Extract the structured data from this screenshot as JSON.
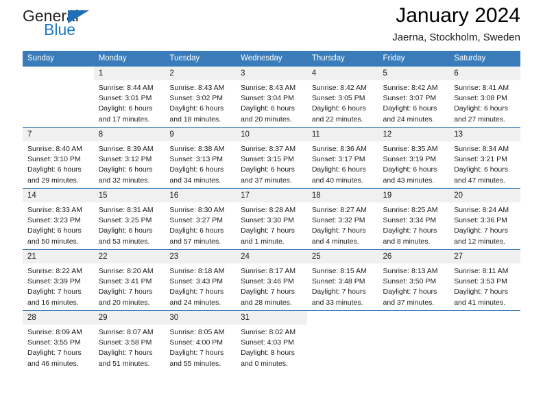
{
  "logo": {
    "word1": "General",
    "word2": "Blue",
    "triangle_color": "#1f6fb4",
    "word2_color": "#1b78c2"
  },
  "header": {
    "title": "January 2024",
    "subtitle": "Jaerna, Stockholm, Sweden"
  },
  "calendar": {
    "header_bg": "#3a7cba",
    "daynum_bg": "#f0f0f0",
    "weekdays": [
      "Sunday",
      "Monday",
      "Tuesday",
      "Wednesday",
      "Thursday",
      "Friday",
      "Saturday"
    ],
    "weeks": [
      [
        null,
        {
          "day": "1",
          "sunrise": "Sunrise: 8:44 AM",
          "sunset": "Sunset: 3:01 PM",
          "daylight1": "Daylight: 6 hours",
          "daylight2": "and 17 minutes."
        },
        {
          "day": "2",
          "sunrise": "Sunrise: 8:43 AM",
          "sunset": "Sunset: 3:02 PM",
          "daylight1": "Daylight: 6 hours",
          "daylight2": "and 18 minutes."
        },
        {
          "day": "3",
          "sunrise": "Sunrise: 8:43 AM",
          "sunset": "Sunset: 3:04 PM",
          "daylight1": "Daylight: 6 hours",
          "daylight2": "and 20 minutes."
        },
        {
          "day": "4",
          "sunrise": "Sunrise: 8:42 AM",
          "sunset": "Sunset: 3:05 PM",
          "daylight1": "Daylight: 6 hours",
          "daylight2": "and 22 minutes."
        },
        {
          "day": "5",
          "sunrise": "Sunrise: 8:42 AM",
          "sunset": "Sunset: 3:07 PM",
          "daylight1": "Daylight: 6 hours",
          "daylight2": "and 24 minutes."
        },
        {
          "day": "6",
          "sunrise": "Sunrise: 8:41 AM",
          "sunset": "Sunset: 3:08 PM",
          "daylight1": "Daylight: 6 hours",
          "daylight2": "and 27 minutes."
        }
      ],
      [
        {
          "day": "7",
          "sunrise": "Sunrise: 8:40 AM",
          "sunset": "Sunset: 3:10 PM",
          "daylight1": "Daylight: 6 hours",
          "daylight2": "and 29 minutes."
        },
        {
          "day": "8",
          "sunrise": "Sunrise: 8:39 AM",
          "sunset": "Sunset: 3:12 PM",
          "daylight1": "Daylight: 6 hours",
          "daylight2": "and 32 minutes."
        },
        {
          "day": "9",
          "sunrise": "Sunrise: 8:38 AM",
          "sunset": "Sunset: 3:13 PM",
          "daylight1": "Daylight: 6 hours",
          "daylight2": "and 34 minutes."
        },
        {
          "day": "10",
          "sunrise": "Sunrise: 8:37 AM",
          "sunset": "Sunset: 3:15 PM",
          "daylight1": "Daylight: 6 hours",
          "daylight2": "and 37 minutes."
        },
        {
          "day": "11",
          "sunrise": "Sunrise: 8:36 AM",
          "sunset": "Sunset: 3:17 PM",
          "daylight1": "Daylight: 6 hours",
          "daylight2": "and 40 minutes."
        },
        {
          "day": "12",
          "sunrise": "Sunrise: 8:35 AM",
          "sunset": "Sunset: 3:19 PM",
          "daylight1": "Daylight: 6 hours",
          "daylight2": "and 43 minutes."
        },
        {
          "day": "13",
          "sunrise": "Sunrise: 8:34 AM",
          "sunset": "Sunset: 3:21 PM",
          "daylight1": "Daylight: 6 hours",
          "daylight2": "and 47 minutes."
        }
      ],
      [
        {
          "day": "14",
          "sunrise": "Sunrise: 8:33 AM",
          "sunset": "Sunset: 3:23 PM",
          "daylight1": "Daylight: 6 hours",
          "daylight2": "and 50 minutes."
        },
        {
          "day": "15",
          "sunrise": "Sunrise: 8:31 AM",
          "sunset": "Sunset: 3:25 PM",
          "daylight1": "Daylight: 6 hours",
          "daylight2": "and 53 minutes."
        },
        {
          "day": "16",
          "sunrise": "Sunrise: 8:30 AM",
          "sunset": "Sunset: 3:27 PM",
          "daylight1": "Daylight: 6 hours",
          "daylight2": "and 57 minutes."
        },
        {
          "day": "17",
          "sunrise": "Sunrise: 8:28 AM",
          "sunset": "Sunset: 3:30 PM",
          "daylight1": "Daylight: 7 hours",
          "daylight2": "and 1 minute."
        },
        {
          "day": "18",
          "sunrise": "Sunrise: 8:27 AM",
          "sunset": "Sunset: 3:32 PM",
          "daylight1": "Daylight: 7 hours",
          "daylight2": "and 4 minutes."
        },
        {
          "day": "19",
          "sunrise": "Sunrise: 8:25 AM",
          "sunset": "Sunset: 3:34 PM",
          "daylight1": "Daylight: 7 hours",
          "daylight2": "and 8 minutes."
        },
        {
          "day": "20",
          "sunrise": "Sunrise: 8:24 AM",
          "sunset": "Sunset: 3:36 PM",
          "daylight1": "Daylight: 7 hours",
          "daylight2": "and 12 minutes."
        }
      ],
      [
        {
          "day": "21",
          "sunrise": "Sunrise: 8:22 AM",
          "sunset": "Sunset: 3:39 PM",
          "daylight1": "Daylight: 7 hours",
          "daylight2": "and 16 minutes."
        },
        {
          "day": "22",
          "sunrise": "Sunrise: 8:20 AM",
          "sunset": "Sunset: 3:41 PM",
          "daylight1": "Daylight: 7 hours",
          "daylight2": "and 20 minutes."
        },
        {
          "day": "23",
          "sunrise": "Sunrise: 8:18 AM",
          "sunset": "Sunset: 3:43 PM",
          "daylight1": "Daylight: 7 hours",
          "daylight2": "and 24 minutes."
        },
        {
          "day": "24",
          "sunrise": "Sunrise: 8:17 AM",
          "sunset": "Sunset: 3:46 PM",
          "daylight1": "Daylight: 7 hours",
          "daylight2": "and 28 minutes."
        },
        {
          "day": "25",
          "sunrise": "Sunrise: 8:15 AM",
          "sunset": "Sunset: 3:48 PM",
          "daylight1": "Daylight: 7 hours",
          "daylight2": "and 33 minutes."
        },
        {
          "day": "26",
          "sunrise": "Sunrise: 8:13 AM",
          "sunset": "Sunset: 3:50 PM",
          "daylight1": "Daylight: 7 hours",
          "daylight2": "and 37 minutes."
        },
        {
          "day": "27",
          "sunrise": "Sunrise: 8:11 AM",
          "sunset": "Sunset: 3:53 PM",
          "daylight1": "Daylight: 7 hours",
          "daylight2": "and 41 minutes."
        }
      ],
      [
        {
          "day": "28",
          "sunrise": "Sunrise: 8:09 AM",
          "sunset": "Sunset: 3:55 PM",
          "daylight1": "Daylight: 7 hours",
          "daylight2": "and 46 minutes."
        },
        {
          "day": "29",
          "sunrise": "Sunrise: 8:07 AM",
          "sunset": "Sunset: 3:58 PM",
          "daylight1": "Daylight: 7 hours",
          "daylight2": "and 51 minutes."
        },
        {
          "day": "30",
          "sunrise": "Sunrise: 8:05 AM",
          "sunset": "Sunset: 4:00 PM",
          "daylight1": "Daylight: 7 hours",
          "daylight2": "and 55 minutes."
        },
        {
          "day": "31",
          "sunrise": "Sunrise: 8:02 AM",
          "sunset": "Sunset: 4:03 PM",
          "daylight1": "Daylight: 8 hours",
          "daylight2": "and 0 minutes."
        },
        null,
        null,
        null
      ]
    ]
  }
}
